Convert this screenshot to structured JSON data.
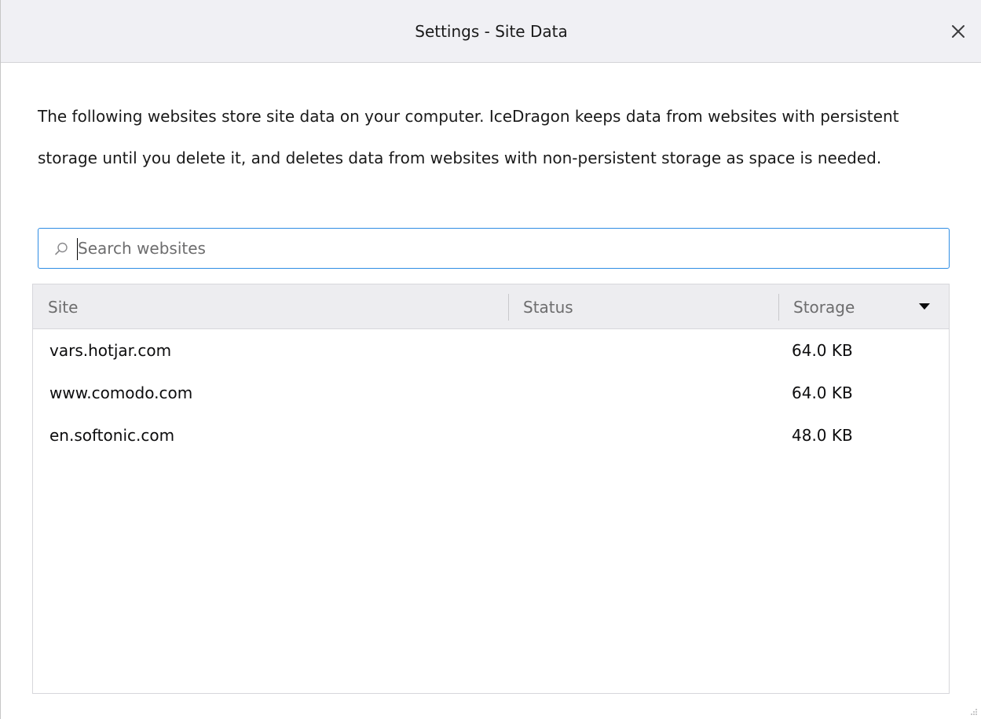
{
  "dialog": {
    "title": "Settings - Site Data",
    "close_icon": "close-icon"
  },
  "description": "The following websites store site data on your computer. IceDragon keeps data from websites with persistent storage until you delete it, and deletes data from websites with non-persistent storage as space is needed.",
  "search": {
    "icon": "search-icon",
    "placeholder": "Search websites",
    "value": ""
  },
  "table": {
    "columns": {
      "site": "Site",
      "status": "Status",
      "storage": "Storage"
    },
    "sort_column": "storage",
    "sort_direction": "descending",
    "rows": [
      {
        "site": "vars.hotjar.com",
        "status": "",
        "storage": "64.0 KB"
      },
      {
        "site": "www.comodo.com",
        "status": "",
        "storage": "64.0 KB"
      },
      {
        "site": "en.softonic.com",
        "status": "",
        "storage": "48.0 KB"
      }
    ]
  },
  "colors": {
    "accent": "#2f8de4",
    "header_bg": "#ededf0",
    "titlebar_bg": "#f0f0f4"
  }
}
